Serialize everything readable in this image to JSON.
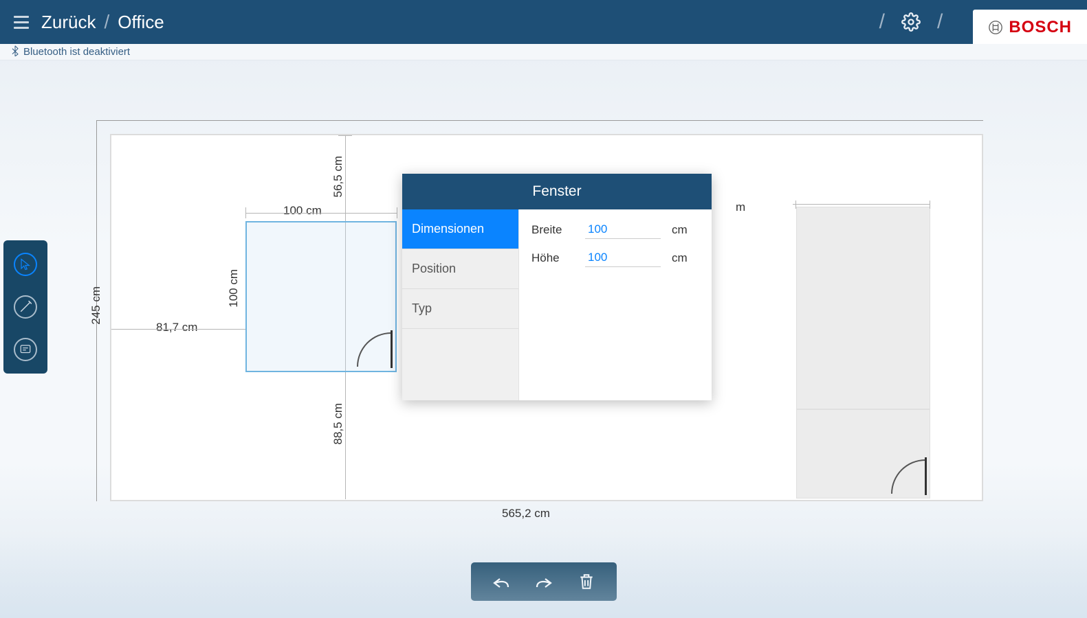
{
  "header": {
    "back_label": "Zurück",
    "crumb": "Office"
  },
  "brand": {
    "name": "BOSCH"
  },
  "status": {
    "bluetooth": "Bluetooth ist deaktiviert"
  },
  "dimensions": {
    "room_height": "245 cm",
    "room_width": "565,2 cm",
    "left_gap": "81,7 cm",
    "top_gap": "56,5 cm",
    "bottom_gap": "88,5 cm",
    "shape_width": "100 cm",
    "shape_height": "100 cm",
    "right_unit": "m"
  },
  "popup": {
    "title": "Fenster",
    "tabs": {
      "dimensions": "Dimensionen",
      "position": "Position",
      "type": "Typ"
    },
    "fields": {
      "width_label": "Breite",
      "width_value": "100",
      "width_unit": "cm",
      "height_label": "Höhe",
      "height_value": "100",
      "height_unit": "cm"
    }
  }
}
